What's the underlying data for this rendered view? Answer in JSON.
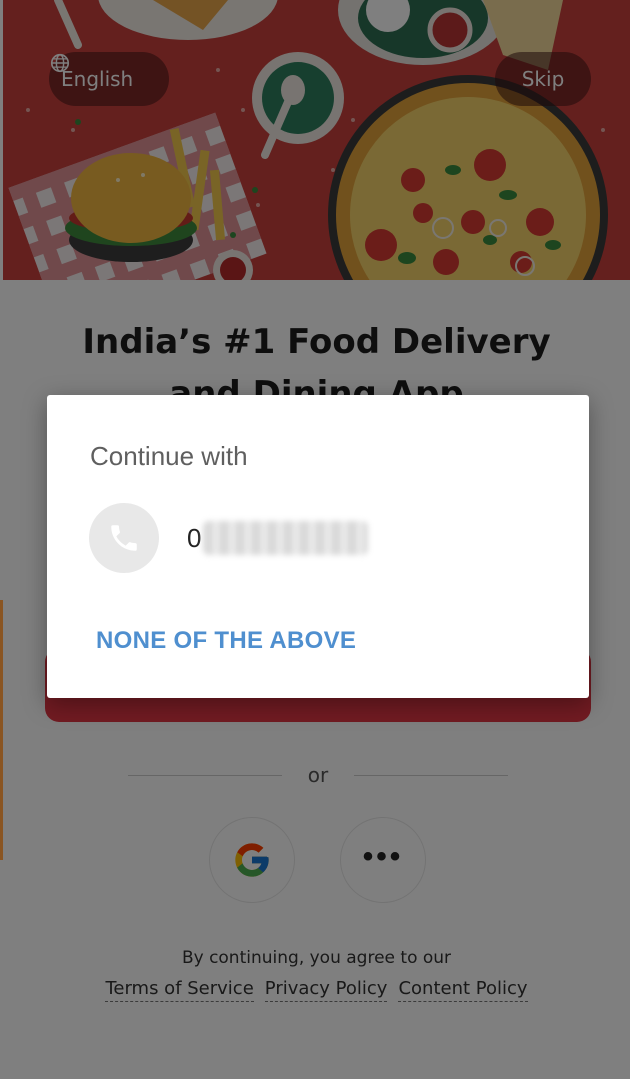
{
  "hero": {
    "language_label": "English",
    "skip_label": "Skip"
  },
  "headline": {
    "line1": "India’s #1 Food Delivery",
    "line2": "and Dining App"
  },
  "divider_text": "or",
  "social": {
    "google_icon": "google-g-icon",
    "more_icon": "more-dots-icon",
    "more_label": "•••"
  },
  "legal": {
    "intro": "By continuing, you agree to our",
    "terms_label": "Terms of Service",
    "privacy_label": "Privacy Policy",
    "content_label": "Content Policy"
  },
  "dialog": {
    "title": "Continue with",
    "phone_icon": "phone-icon",
    "phone_prefix": "0",
    "none_label": "NONE OF THE ABOVE"
  },
  "colors": {
    "hero_red": "#c9403d",
    "cta_red": "#e23744",
    "link_blue": "#4f8fcf"
  }
}
